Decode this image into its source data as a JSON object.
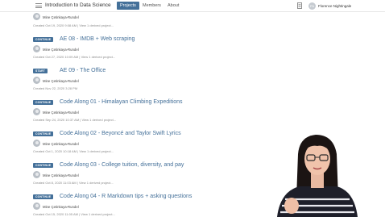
{
  "header": {
    "app_title": "Introduction to Data Science",
    "tabs": [
      {
        "label": "Projects",
        "active": true
      },
      {
        "label": "Members",
        "active": false
      },
      {
        "label": "About",
        "active": false
      }
    ],
    "user_name": "Florence Nightingale",
    "user_initials": "FN"
  },
  "top_meta": {
    "created": "Created Oct 19, 2020 9:08 AM",
    "sep": "|",
    "link": "View 1 derived project..."
  },
  "items": [
    {
      "badge": "CONTINUE",
      "title": "AE 08 - IMDB + Web scraping",
      "author": "Mine Çetinkaya-Rundel",
      "created": "Created Oct 27, 2020 10:09 AM",
      "sep": "|",
      "link": "View 1 derived project..."
    },
    {
      "badge": "START",
      "title": "AE 09 - The Office",
      "author": "Mine Çetinkaya-Rundel",
      "created": "Created Nov 22, 2020 3:28 PM",
      "sep": "",
      "link": ""
    },
    {
      "badge": "CONTINUE",
      "title": "Code Along 01 - Himalayan Climbing Expeditions",
      "author": "Mine Çetinkaya-Rundel",
      "created": "Created Sep 24, 2020 10:37 AM",
      "sep": "|",
      "link": "View 1 derived project..."
    },
    {
      "badge": "CONTINUE",
      "title": "Code Along 02 - Beyoncé and Taylor Swift Lyrics",
      "author": "Mine Çetinkaya-Rundel",
      "created": "Created Oct 1, 2020 10:18 AM",
      "sep": "|",
      "link": "View 1 derived project..."
    },
    {
      "badge": "CONTINUE",
      "title": "Code Along 03 - College tuition, diversity, and pay",
      "author": "Mine Çetinkaya-Rundel",
      "created": "Created Oct 8, 2020 11:03 AM",
      "sep": "|",
      "link": "View 1 derived project..."
    },
    {
      "badge": "CONTINUE",
      "title": "Code Along 04 - R Markdown tips + asking questions",
      "author": "Mine Çetinkaya-Rundel",
      "created": "Created Oct 15, 2020 11:05 AM",
      "sep": "|",
      "link": "View 1 derived project..."
    }
  ],
  "colors": {
    "accent": "#447099",
    "header_bg": "#ffffff"
  },
  "icons": [
    "hamburger-icon",
    "notebook-icon",
    "avatar"
  ]
}
